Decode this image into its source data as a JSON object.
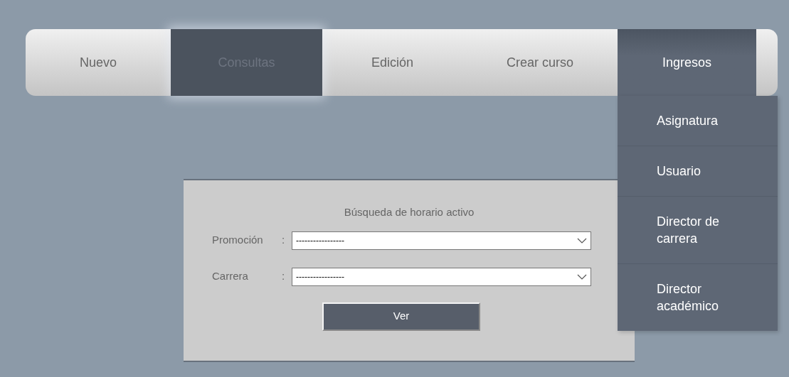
{
  "menu": [
    {
      "label": "Nuevo",
      "selected": false,
      "expanded": false
    },
    {
      "label": "Consultas",
      "selected": true,
      "expanded": false
    },
    {
      "label": "Edición",
      "selected": false,
      "expanded": false
    },
    {
      "label": "Crear curso",
      "selected": false,
      "expanded": false
    },
    {
      "label": "Ingresos",
      "selected": false,
      "expanded": true,
      "children": [
        {
          "label": "Asignatura"
        },
        {
          "label": "Usuario"
        },
        {
          "label": "Director de carrera"
        },
        {
          "label": "Director académico"
        }
      ]
    }
  ],
  "form": {
    "title": "Búsqueda de horario activo",
    "fields": [
      {
        "label": "Promoción",
        "separator": ":",
        "value": "-----------------"
      },
      {
        "label": "Carrera",
        "separator": ":",
        "value": "-----------------"
      }
    ],
    "button": "Ver"
  }
}
